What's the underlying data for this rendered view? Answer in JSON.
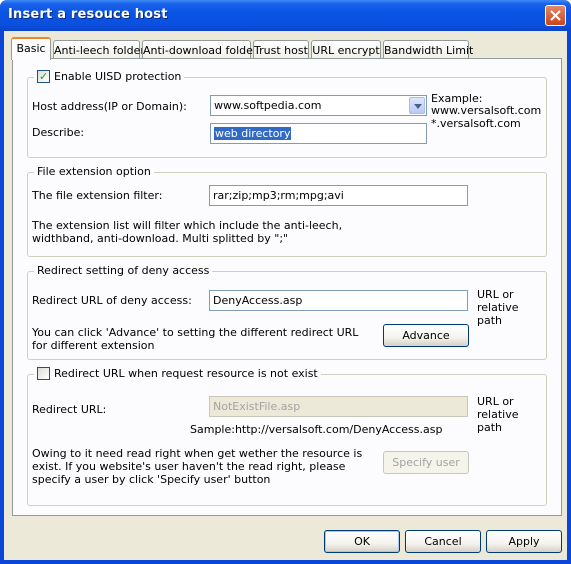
{
  "window": {
    "title": "Insert a resouce host"
  },
  "tabs": [
    {
      "label": "Basic"
    },
    {
      "label": "Anti-leech folder"
    },
    {
      "label": "Anti-download folder"
    },
    {
      "label": "Trust host"
    },
    {
      "label": "URL encrypt"
    },
    {
      "label": "Bandwidth Limit"
    }
  ],
  "uisd": {
    "checkbox_label": "Enable UISD protection",
    "checked": true,
    "host_label": "Host address(IP or Domain):",
    "host_value": "www.softpedia.com",
    "describe_label": "Describe:",
    "describe_value": "web directory",
    "example_title": "Example:",
    "example_line1": "www.versalsoft.com",
    "example_line2": "*.versalsoft.com"
  },
  "file_ext": {
    "title": "File extension option",
    "filter_label": "The file extension filter:",
    "filter_value": "rar;zip;mp3;rm;mpg;avi",
    "note": "The extension list will filter which include the anti-leech, widthband, anti-download. Multi splitted by \";\""
  },
  "redirect_deny": {
    "title": "Redirect setting of deny access",
    "url_label": "Redirect URL of deny access:",
    "url_value": "DenyAccess.asp",
    "hint": "URL or relative path",
    "note": "You can click 'Advance' to setting the different  redirect URL for different extension",
    "advance_button": "Advance"
  },
  "redirect_notexist": {
    "checkbox_label": "Redirect URL when request resource is not exist",
    "checked": false,
    "url_label": "Redirect URL:",
    "url_value": "NotExistFile.asp",
    "hint": "URL or relative path",
    "sample": "Sample:http://versalsoft.com/DenyAccess.asp",
    "note": "Owing to it need read right when get wether the resource is exist. If you website's user haven't the read right, please specify a user by click 'Specify user' button",
    "specify_button": "Specify user"
  },
  "footer": {
    "ok": "OK",
    "cancel": "Cancel",
    "apply": "Apply"
  },
  "colors": {
    "titlebar": "#0a55e6",
    "dialog_bg": "#ece9d8",
    "active_tab_accent": "#e68b2c"
  }
}
